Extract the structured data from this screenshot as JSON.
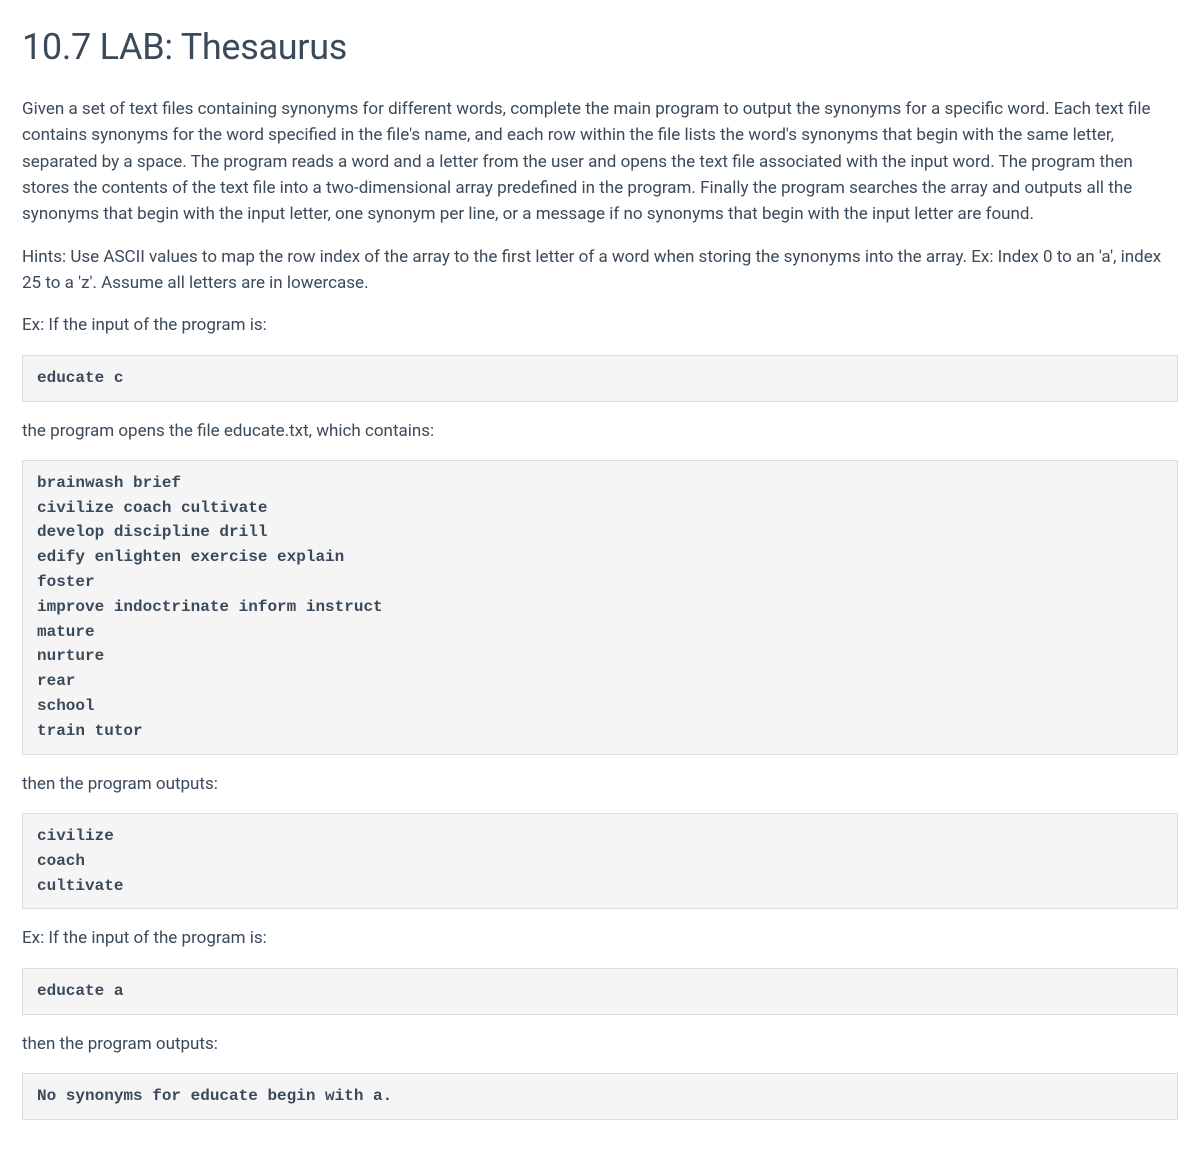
{
  "title": "10.7 LAB: Thesaurus",
  "paragraphs": {
    "intro": "Given a set of text files containing synonyms for different words, complete the main program to output the synonyms for a specific word. Each text file contains synonyms for the word specified in the file's name, and each row within the file lists the word's synonyms that begin with the same letter, separated by a space. The program reads a word and a letter from the user and opens the text file associated with the input word. The program then stores the contents of the text file into a two-dimensional array predefined in the program. Finally the program searches the array and outputs all the synonyms that begin with the input letter, one synonym per line, or a message if no synonyms that begin with the input letter are found.",
    "hints": "Hints: Use ASCII values to map the row index of the array to the first letter of a word when storing the synonyms into the array. Ex: Index 0 to an 'a', index 25 to a 'z'. Assume all letters are in lowercase.",
    "ex1_input_label": "Ex: If the input of the program is:",
    "ex1_file_label": "the program opens the file educate.txt, which contains:",
    "ex1_output_label": "then the program outputs:",
    "ex2_input_label": "Ex: If the input of the program is:",
    "ex2_output_label": "then the program outputs:"
  },
  "code": {
    "ex1_input": "educate c",
    "file_contents": "brainwash brief\ncivilize coach cultivate\ndevelop discipline drill\nedify enlighten exercise explain\nfoster\nimprove indoctrinate inform instruct\nmature\nnurture\nrear\nschool\ntrain tutor",
    "ex1_output": "civilize\ncoach\ncultivate",
    "ex2_input": "educate a",
    "ex2_output": "No synonyms for educate begin with a."
  }
}
